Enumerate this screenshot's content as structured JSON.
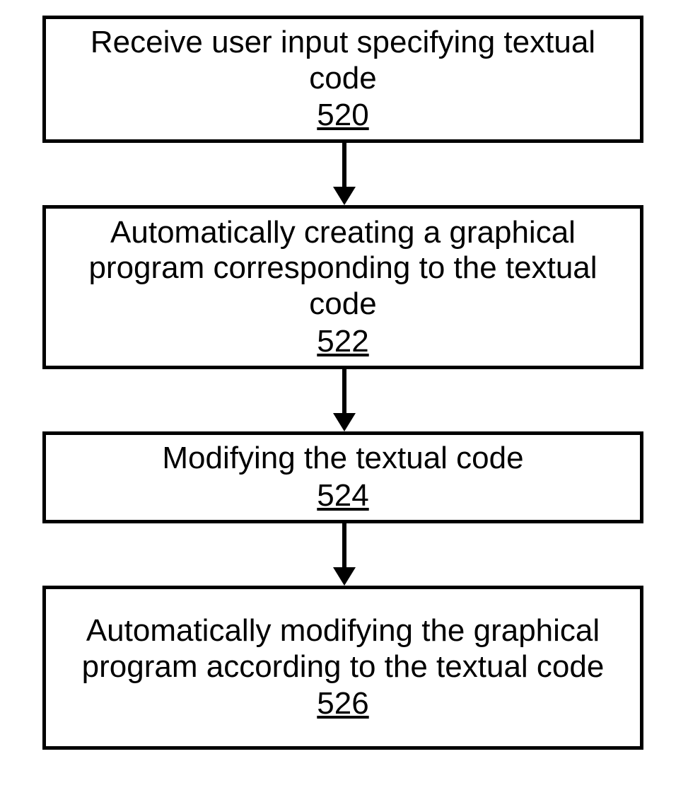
{
  "diagram": {
    "nodes": [
      {
        "text": "Receive user input specifying textual code",
        "ref": "520"
      },
      {
        "text": "Automatically creating a graphical program corresponding to the textual code",
        "ref": "522"
      },
      {
        "text": "Modifying the textual code",
        "ref": "524"
      },
      {
        "text": "Automatically modifying the graphical program according to the textual code",
        "ref": "526"
      }
    ]
  }
}
